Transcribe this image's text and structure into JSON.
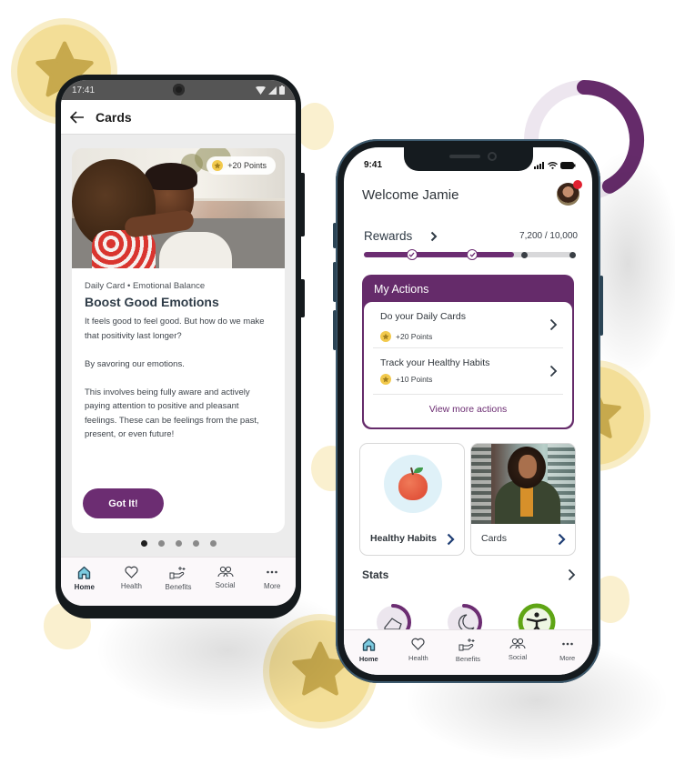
{
  "android": {
    "status_time": "17:41",
    "appbar": {
      "title": "Cards"
    },
    "card": {
      "points_chip": "+20 Points",
      "meta": "Daily Card • Emotional Balance",
      "title": "Boost Good Emotions",
      "paragraphs": [
        "It feels good to feel good. But how do we make that positivity last longer?",
        "By savoring our emotions.",
        "This involves being fully aware and actively paying attention to positive and pleasant feelings. These can be feelings from the past, present, or even future!"
      ],
      "button_label": "Got It!"
    },
    "pager": {
      "total": 5,
      "active_index": 0
    },
    "tabs": [
      {
        "label": "Home",
        "icon": "home-icon",
        "active": true
      },
      {
        "label": "Health",
        "icon": "heart-icon",
        "active": false
      },
      {
        "label": "Benefits",
        "icon": "benefits-hand-icon",
        "active": false
      },
      {
        "label": "Social",
        "icon": "people-icon",
        "active": false
      },
      {
        "label": "More",
        "icon": "more-dots-icon",
        "active": false
      }
    ]
  },
  "iphone": {
    "status_time": "9:41",
    "welcome": "Welcome Jamie",
    "rewards": {
      "label": "Rewards",
      "value_text": "7,200 / 10,000",
      "current": 7200,
      "goal": 10000,
      "progress_fraction": 0.72
    },
    "my_actions": {
      "title": "My Actions",
      "items": [
        {
          "title": "Do your Daily Cards",
          "points": "+20 Points"
        },
        {
          "title": "Track your Healthy Habits",
          "points": "+10 Points"
        }
      ],
      "view_more": "View more actions"
    },
    "tiles": [
      {
        "label": "Healthy Habits",
        "image": "apple-icon"
      },
      {
        "label": "Cards",
        "image": "woman-photo"
      }
    ],
    "stats": {
      "label": "Stats",
      "rings": [
        {
          "icon": "shoe-icon",
          "fraction": 0.45,
          "color": "#6c2d72"
        },
        {
          "icon": "moon-icon",
          "fraction": 0.45,
          "color": "#6c2d72"
        },
        {
          "icon": "activity-person-icon",
          "fraction": 1.0,
          "color": "#5fa515"
        }
      ]
    },
    "tabs": [
      {
        "label": "Home",
        "icon": "home-icon",
        "active": true
      },
      {
        "label": "Health",
        "icon": "heart-icon",
        "active": false
      },
      {
        "label": "Benefits",
        "icon": "benefits-hand-icon",
        "active": false
      },
      {
        "label": "Social",
        "icon": "people-icon",
        "active": false
      },
      {
        "label": "More",
        "icon": "more-dots-icon",
        "active": false
      }
    ]
  },
  "colors": {
    "brand_purple": "#6c2d72",
    "coin_gold": "#f3de97",
    "star_gold": "#c7a94d",
    "stat_green": "#5fa515",
    "notification_red": "#e0202f"
  }
}
